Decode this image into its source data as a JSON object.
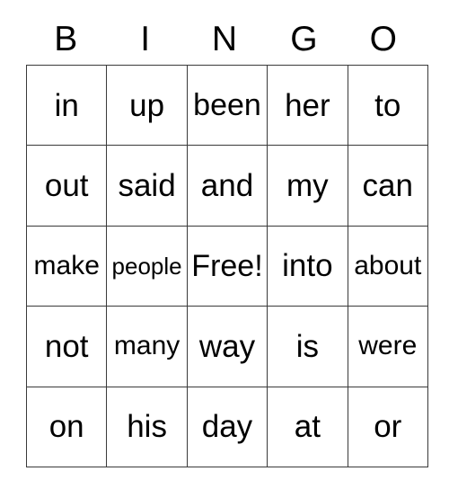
{
  "card": {
    "headers": [
      "B",
      "I",
      "N",
      "G",
      "O"
    ],
    "rows": [
      [
        {
          "text": "in",
          "size": "xl"
        },
        {
          "text": "up",
          "size": "xl"
        },
        {
          "text": "been",
          "size": "lg"
        },
        {
          "text": "her",
          "size": "xl"
        },
        {
          "text": "to",
          "size": "xl"
        }
      ],
      [
        {
          "text": "out",
          "size": "xl"
        },
        {
          "text": "said",
          "size": "xl"
        },
        {
          "text": "and",
          "size": "xl"
        },
        {
          "text": "my",
          "size": "xl"
        },
        {
          "text": "can",
          "size": "xl"
        }
      ],
      [
        {
          "text": "make",
          "size": "md"
        },
        {
          "text": "people",
          "size": "sm"
        },
        {
          "text": "Free!",
          "size": "lg"
        },
        {
          "text": "into",
          "size": "xl"
        },
        {
          "text": "about",
          "size": "md"
        }
      ],
      [
        {
          "text": "not",
          "size": "xl"
        },
        {
          "text": "many",
          "size": "md"
        },
        {
          "text": "way",
          "size": "xl"
        },
        {
          "text": "is",
          "size": "xl"
        },
        {
          "text": "were",
          "size": "md"
        }
      ],
      [
        {
          "text": "on",
          "size": "xl"
        },
        {
          "text": "his",
          "size": "xl"
        },
        {
          "text": "day",
          "size": "xl"
        },
        {
          "text": "at",
          "size": "xl"
        },
        {
          "text": "or",
          "size": "xl"
        }
      ]
    ],
    "free_space": "Free!",
    "colors": {
      "background": "#ffffff",
      "text": "#000000",
      "grid_line": "#3a3a3a"
    }
  }
}
